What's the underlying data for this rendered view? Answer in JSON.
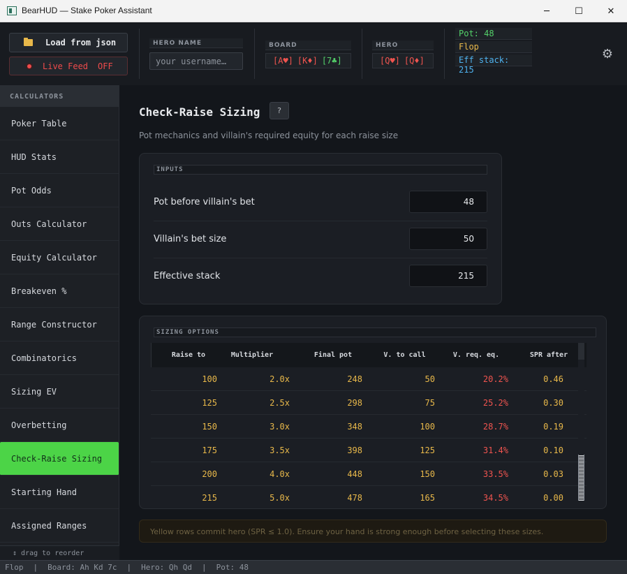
{
  "window": {
    "title": "BearHUD — Stake Poker Assistant",
    "minimize_glyph": "─",
    "maximize_glyph": "☐",
    "close_glyph": "✕"
  },
  "header": {
    "load_button": "Load from json",
    "live_feed_label": "Live Feed",
    "live_feed_state": "OFF",
    "hero_name_label": "HERO NAME",
    "hero_name_placeholder": "your username…",
    "board_label": "BOARD",
    "board_cards": [
      "[A♥]",
      "[K♦]",
      "[7♣]"
    ],
    "hero_label": "HERO",
    "hero_cards": [
      "[Q♥]",
      "[Q♦]"
    ],
    "pot_line": "Pot: 48",
    "street_line": "Flop",
    "stack_line": "Eff stack: 215",
    "gear_glyph": "⚙",
    "colors": {
      "accent_green": "#4cd447",
      "red": "#f0544f",
      "yellow": "#e8b84a",
      "blue": "#4fb3f0"
    }
  },
  "sidebar": {
    "heading": "CALCULATORS",
    "items": [
      "Poker Table",
      "HUD Stats",
      "Pot Odds",
      "Outs Calculator",
      "Equity Calculator",
      "Breakeven %",
      "Range Constructor",
      "Combinatorics",
      "Sizing EV",
      "Overbetting",
      "Check-Raise Sizing",
      "Starting Hand",
      "Assigned Ranges"
    ],
    "active_index": 10,
    "footer": "↕ drag to reorder"
  },
  "main": {
    "title": "Check-Raise Sizing",
    "help_label": "?",
    "subtitle": "Pot mechanics and villain's required equity for each raise size",
    "inputs": {
      "label": "INPUTS",
      "rows": [
        {
          "label": "Pot before villain's bet",
          "value": "48"
        },
        {
          "label": "Villain's bet size",
          "value": "50"
        },
        {
          "label": "Effective stack",
          "value": "215"
        }
      ]
    },
    "sizing": {
      "label": "SIZING OPTIONS",
      "headers": [
        "Raise to",
        "Multiplier",
        "Final pot",
        "V. to call",
        "V. req. eq.",
        "SPR after"
      ],
      "rows": [
        [
          "100",
          "2.0x",
          "248",
          "50",
          "20.2%",
          "0.46"
        ],
        [
          "125",
          "2.5x",
          "298",
          "75",
          "25.2%",
          "0.30"
        ],
        [
          "150",
          "3.0x",
          "348",
          "100",
          "28.7%",
          "0.19"
        ],
        [
          "175",
          "3.5x",
          "398",
          "125",
          "31.4%",
          "0.10"
        ],
        [
          "200",
          "4.0x",
          "448",
          "150",
          "33.5%",
          "0.03"
        ],
        [
          "215",
          "5.0x",
          "478",
          "165",
          "34.5%",
          "0.00"
        ]
      ]
    },
    "notice": "Yellow rows commit hero (SPR ≤ 1.0). Ensure your hand is strong enough before selecting these sizes."
  },
  "statusbar": {
    "street": "Flop",
    "board": "Board: Ah Kd 7c",
    "hero": "Hero: Qh Qd",
    "pot": "Pot: 48",
    "separator": "|"
  }
}
